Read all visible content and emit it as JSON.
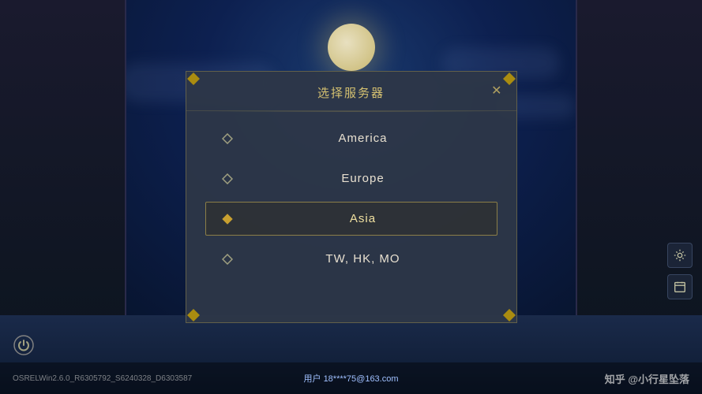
{
  "background": {
    "moon_color": "#c8b870"
  },
  "modal": {
    "title": "选择服务器",
    "close_label": "✕",
    "servers": [
      {
        "id": "america",
        "name": "America",
        "selected": false
      },
      {
        "id": "europe",
        "name": "Europe",
        "selected": false
      },
      {
        "id": "asia",
        "name": "Asia",
        "selected": true
      },
      {
        "id": "twhkmo",
        "name": "TW, HK, MO",
        "selected": false
      }
    ]
  },
  "bottom_bar": {
    "version": "OSRELWin2.6.0_R6305792_S6240328_D6303587",
    "user_label": "用户",
    "user_value": "18****75@163.com",
    "watermark": "知乎 @小行星坠落"
  },
  "right_icons": [
    {
      "id": "settings",
      "icon": "⚙"
    },
    {
      "id": "calendar",
      "icon": "📋"
    }
  ]
}
